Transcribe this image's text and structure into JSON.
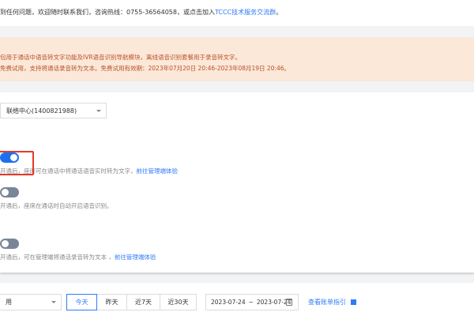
{
  "notice": {
    "text": "到任何问题，欢迎随时联系我们，咨询热线：0755-36564058，或点击加入",
    "link": "TCCC技术服务交流群",
    "end": "。"
  },
  "alert": {
    "line1": "包用于通话中语音转文字功能及IVR语音识别导航模块，离线语音识别套餐用于录音转文字。",
    "line2": "免费试用，支持将通话录音转为文本。免费试用有效期：2023年07月20日 20:46-2023年08月19日 20:46。"
  },
  "center_select": {
    "value": "联络中心(1400821988)"
  },
  "settings": [
    {
      "enabled": true,
      "desc": "开通后，座席可在通话中将通话语音实时转为文字，",
      "link": "前往管理端体验"
    },
    {
      "enabled": false,
      "desc": "开通后，座席在通话时自动开启语音识别。",
      "link": ""
    },
    {
      "enabled": false,
      "desc": "开通后，可在管理端将通话录音转为文本 ，",
      "link": "前往管理端体验"
    }
  ],
  "billing": {
    "select_value": "用",
    "ranges": [
      "今天",
      "昨天",
      "近7天",
      "近30天"
    ],
    "active_range": "今天",
    "date_start": "2023-07-24",
    "date_sep": "~",
    "date_end": "2023-07-24",
    "guide_link": "查看账单指引"
  }
}
